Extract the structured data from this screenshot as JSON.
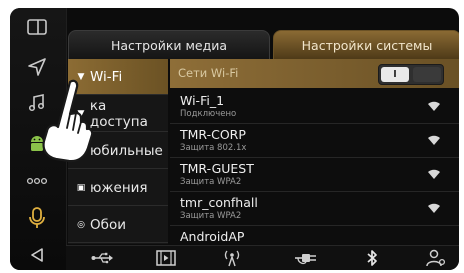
{
  "tabs": {
    "media": "Настройки медиа",
    "system": "Настройки системы"
  },
  "categories": [
    {
      "label": "Wi-Fi",
      "icon": "wifi-icon"
    },
    {
      "label": "ка доступа",
      "icon": "access-point-icon"
    },
    {
      "label": "юбильные",
      "icon": "mobile-data-icon"
    },
    {
      "label": "южения",
      "icon": "apps-icon"
    },
    {
      "label": "Обои",
      "icon": "wallpaper-icon"
    }
  ],
  "wifi": {
    "header_label": "Сети Wi-Fi",
    "toggle_label": "I"
  },
  "networks": [
    {
      "name": "Wi-Fi_1",
      "sub": "Подключено"
    },
    {
      "name": "TMR-CORP",
      "sub": "Защита 802.1x"
    },
    {
      "name": "TMR-GUEST",
      "sub": "Защита WPA2"
    },
    {
      "name": "tmr_confhall",
      "sub": "Защита WPA2"
    },
    {
      "name": "AndroidAP",
      "sub": ""
    }
  ],
  "colors": {
    "accent": "#8c6c34",
    "background": "#0c0c0c",
    "android_green": "#8bc34a"
  }
}
